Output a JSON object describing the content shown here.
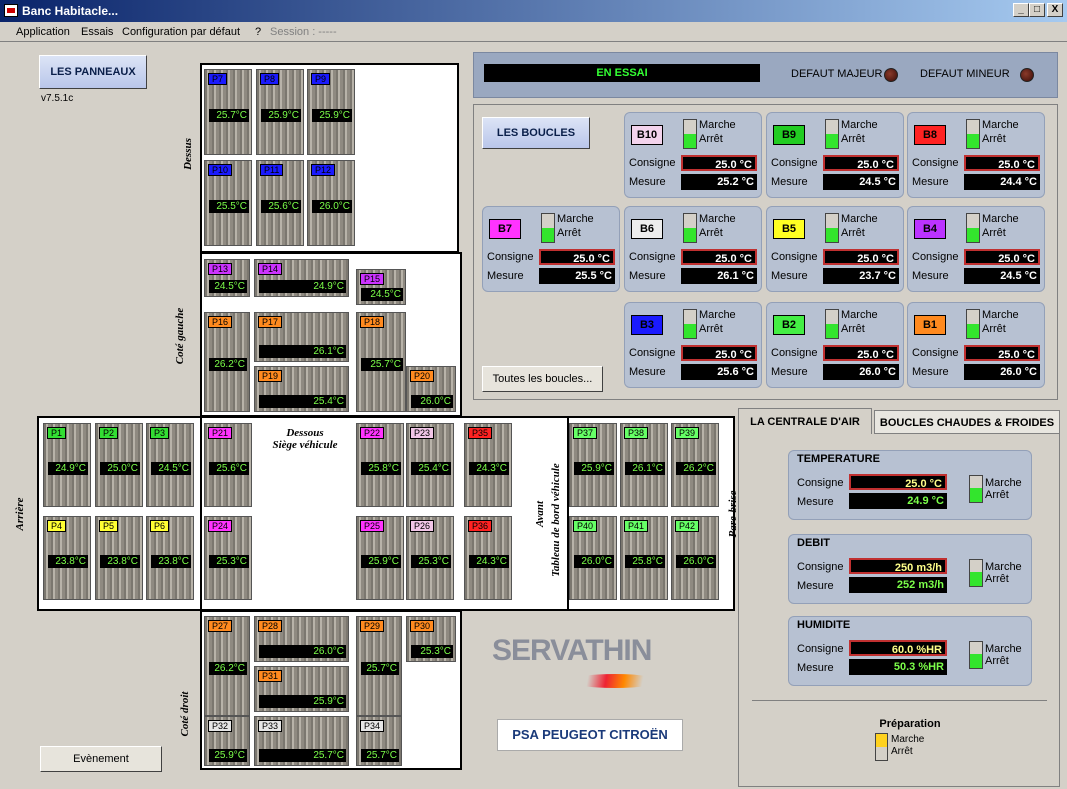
{
  "window": {
    "title": "Banc Habitacle...",
    "minimize": "_",
    "maximize": "□",
    "close": "X"
  },
  "menu": {
    "application": "Application",
    "essais": "Essais",
    "configuration": "Configuration par défaut",
    "help": "?",
    "session": "Session : -----"
  },
  "left": {
    "panneaux_button": "LES PANNEAUX",
    "version": "v7.5.1c",
    "evenement_button": "Evènement"
  },
  "sections": {
    "dessus": "Dessus",
    "cote_gauche": "Coté gauche",
    "dessous": "Dessous",
    "siege": "Siège véhicule",
    "arriere": "Arrière",
    "avant": "Avant",
    "tableau": "Tableau de bord véhicule",
    "pare_brise": "Pare-brise",
    "cote_droit": "Coté droit"
  },
  "panels": [
    {
      "id": "P7",
      "temp": "25.7°C",
      "color": "#1a1aff"
    },
    {
      "id": "P8",
      "temp": "25.9°C",
      "color": "#1a1aff"
    },
    {
      "id": "P9",
      "temp": "25.9°C",
      "color": "#1a1aff"
    },
    {
      "id": "P10",
      "temp": "25.5°C",
      "color": "#1a1aff"
    },
    {
      "id": "P11",
      "temp": "25.6°C",
      "color": "#1a1aff"
    },
    {
      "id": "P12",
      "temp": "26.0°C",
      "color": "#1a1aff"
    },
    {
      "id": "P13",
      "temp": "24.5°C",
      "color": "#cc33ff"
    },
    {
      "id": "P14",
      "temp": "24.9°C",
      "color": "#cc33ff"
    },
    {
      "id": "P15",
      "temp": "24.5°C",
      "color": "#cc33ff"
    },
    {
      "id": "P16",
      "temp": "26.2°C",
      "color": "#ff8a1f"
    },
    {
      "id": "P17",
      "temp": "26.1°C",
      "color": "#ff8a1f"
    },
    {
      "id": "P18",
      "temp": "25.7°C",
      "color": "#ff8a1f"
    },
    {
      "id": "P19",
      "temp": "25.4°C",
      "color": "#ff8a1f"
    },
    {
      "id": "P20",
      "temp": "26.0°C",
      "color": "#ff8a1f"
    },
    {
      "id": "P1",
      "temp": "24.9°C",
      "color": "#33dd33"
    },
    {
      "id": "P2",
      "temp": "25.0°C",
      "color": "#33dd33"
    },
    {
      "id": "P3",
      "temp": "24.5°C",
      "color": "#33dd33"
    },
    {
      "id": "P4",
      "temp": "23.8°C",
      "color": "#ffff33"
    },
    {
      "id": "P5",
      "temp": "23.8°C",
      "color": "#ffff33"
    },
    {
      "id": "P6",
      "temp": "23.8°C",
      "color": "#ffff33"
    },
    {
      "id": "P21",
      "temp": "25.6°C",
      "color": "#ff33ff"
    },
    {
      "id": "P24",
      "temp": "25.3°C",
      "color": "#ff33ff"
    },
    {
      "id": "P22",
      "temp": "25.8°C",
      "color": "#ff33ff"
    },
    {
      "id": "P23",
      "temp": "25.4°C",
      "color": "#f2c6e8"
    },
    {
      "id": "P25",
      "temp": "25.9°C",
      "color": "#ff33ff"
    },
    {
      "id": "P26",
      "temp": "25.3°C",
      "color": "#f2c6e8"
    },
    {
      "id": "P35",
      "temp": "24.3°C",
      "color": "#ff2222"
    },
    {
      "id": "P36",
      "temp": "24.3°C",
      "color": "#ff2222"
    },
    {
      "id": "P37",
      "temp": "25.9°C",
      "color": "#66ff66"
    },
    {
      "id": "P38",
      "temp": "26.1°C",
      "color": "#66ff66"
    },
    {
      "id": "P39",
      "temp": "26.2°C",
      "color": "#66ff66"
    },
    {
      "id": "P40",
      "temp": "26.0°C",
      "color": "#66ff66"
    },
    {
      "id": "P41",
      "temp": "25.8°C",
      "color": "#66ff66"
    },
    {
      "id": "P42",
      "temp": "26.0°C",
      "color": "#66ff66"
    },
    {
      "id": "P27",
      "temp": "26.2°C",
      "color": "#ff8a1f"
    },
    {
      "id": "P28",
      "temp": "26.0°C",
      "color": "#ff8a1f"
    },
    {
      "id": "P29",
      "temp": "25.7°C",
      "color": "#ff8a1f"
    },
    {
      "id": "P30",
      "temp": "25.3°C",
      "color": "#ff8a1f"
    },
    {
      "id": "P31",
      "temp": "25.9°C",
      "color": "#ff8a1f"
    },
    {
      "id": "P32",
      "temp": "25.9°C",
      "color": "#e6e6e6"
    },
    {
      "id": "P33",
      "temp": "25.7°C",
      "color": "#e6e6e6"
    },
    {
      "id": "P34",
      "temp": "25.7°C",
      "color": "#e6e6e6"
    }
  ],
  "status": {
    "text": "EN ESSAI",
    "defaut_majeur": "DEFAUT MAJEUR",
    "defaut_mineur": "DEFAUT MINEUR"
  },
  "boucles": {
    "button": "LES BOUCLES",
    "all_button": "Toutes les boucles...",
    "marche": "Marche",
    "arret": "Arrêt",
    "consigne": "Consigne",
    "mesure": "Mesure",
    "items": [
      {
        "id": "B10",
        "color": "#f3d3ec",
        "consigne": "25.0 °C",
        "mesure": "25.2 °C"
      },
      {
        "id": "B9",
        "color": "#22cc22",
        "consigne": "25.0 °C",
        "mesure": "24.5 °C"
      },
      {
        "id": "B8",
        "color": "#ff2222",
        "consigne": "25.0 °C",
        "mesure": "24.4 °C"
      },
      {
        "id": "B7",
        "color": "#ff33ff",
        "consigne": "25.0 °C",
        "mesure": "25.5 °C"
      },
      {
        "id": "B6",
        "color": "#ededed",
        "consigne": "25.0 °C",
        "mesure": "26.1 °C"
      },
      {
        "id": "B5",
        "color": "#ffff22",
        "consigne": "25.0 °C",
        "mesure": "23.7 °C"
      },
      {
        "id": "B4",
        "color": "#bb33ff",
        "consigne": "25.0 °C",
        "mesure": "24.5 °C"
      },
      {
        "id": "B3",
        "color": "#1a1aff",
        "consigne": "25.0 °C",
        "mesure": "25.6 °C"
      },
      {
        "id": "B2",
        "color": "#44ee44",
        "consigne": "25.0 °C",
        "mesure": "26.0 °C"
      },
      {
        "id": "B1",
        "color": "#ff8a1f",
        "consigne": "25.0 °C",
        "mesure": "26.0 °C"
      }
    ]
  },
  "tabs": {
    "centrale": "LA CENTRALE D'AIR",
    "chaudes": "BOUCLES CHAUDES & FROIDES"
  },
  "centrale": [
    {
      "title": "TEMPERATURE",
      "consigne": "25.0 °C",
      "mesure": "24.9 °C"
    },
    {
      "title": "DEBIT",
      "consigne": "250 m3/h",
      "mesure": "252 m3/h"
    },
    {
      "title": "HUMIDITE",
      "consigne": "60.0 %HR",
      "mesure": "50.3 %HR"
    }
  ],
  "preparation": {
    "title": "Préparation",
    "marche": "Marche",
    "arret": "Arrêt"
  },
  "logos": {
    "servathin": "SERVATHIN",
    "psa": "PSA PEUGEOT CITROËN"
  }
}
